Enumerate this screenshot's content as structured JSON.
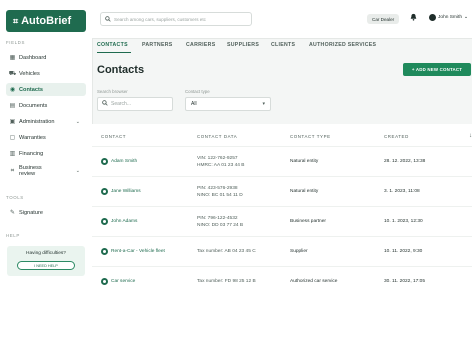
{
  "app": {
    "logo_text": "AutoBrief",
    "logo_mark": "⌗"
  },
  "sidebar": {
    "fields_label": "FIELDS",
    "items": [
      {
        "label": "Dashboard",
        "icon": "dashboard-icon",
        "glyph": "▦"
      },
      {
        "label": "Vehicles",
        "icon": "car-icon",
        "glyph": "⛟"
      },
      {
        "label": "Contacts",
        "icon": "contacts-icon",
        "glyph": "◉",
        "active": true
      },
      {
        "label": "Documents",
        "icon": "document-icon",
        "glyph": "▤"
      },
      {
        "label": "Administration",
        "icon": "admin-icon",
        "glyph": "▣",
        "chevron": "⌄"
      },
      {
        "label": "Warranties",
        "icon": "warranty-icon",
        "glyph": "▢"
      },
      {
        "label": "Financing",
        "icon": "financing-icon",
        "glyph": "▥"
      },
      {
        "label": "Business review",
        "icon": "chart-icon",
        "glyph": "⌗",
        "chevron": "⌄"
      }
    ],
    "tools_label": "TOOLS",
    "tools": [
      {
        "label": "Signature",
        "icon": "signature-icon",
        "glyph": "✎"
      }
    ],
    "help_label": "HELP",
    "help_title": "Having difficulties?",
    "help_button": "I NEED HELP"
  },
  "topbar": {
    "search_placeholder": "Search among cars, suppliers, customers etc",
    "role_chip": "Car Dealer",
    "user_name": "John Smith",
    "user_chevron": "⌄"
  },
  "tabs": [
    "CONTACTS",
    "PARTNERS",
    "CARRIERS",
    "SUPPLIERS",
    "CLIENTS",
    "AUTHORIZED SERVICES"
  ],
  "page_title": "Contacts",
  "add_button": "+ ADD NEW CONTACT",
  "filters": {
    "search_label": "Search browser",
    "search_placeholder": "Search...",
    "type_label": "Contact type",
    "type_value": "All"
  },
  "table": {
    "headers": [
      "CONTACT",
      "CONTACT DATA",
      "CONTACT TYPE",
      "CREATED"
    ],
    "rows": [
      {
        "name": "Adam Smith",
        "data1": "VIN: 122-762-9257",
        "data2": "HMRC: AA 01 23 44 B",
        "type": "Natural entity",
        "created": "28. 12. 2022, 13:38"
      },
      {
        "name": "Jane Williams",
        "data1": "PIN: 423-576-2938",
        "data2": "NINO: BC 01 54 11 D",
        "type": "Natural entity",
        "created": "3. 1. 2023, 11:08"
      },
      {
        "name": "John Adams",
        "data1": "PIN: 796-122-4532",
        "data2": "NINO: DD 03 77 24 B",
        "type": "Business partner",
        "created": "10. 1. 2023, 12:30"
      },
      {
        "name": "Rent-a-Car - Vehicle fleet",
        "data1": "Tax number: AB 04 23 45 C",
        "data2": "",
        "type": "Supplier",
        "created": "10. 11. 2022, 9:30"
      },
      {
        "name": "Car service",
        "data1": "Tax number: FD 98 25 12 B",
        "data2": "",
        "type": "Authorized car service",
        "created": "30. 11. 2022, 17:05"
      }
    ]
  },
  "colors": {
    "brand": "#1f6b4f",
    "accent": "#1f8a5c"
  }
}
